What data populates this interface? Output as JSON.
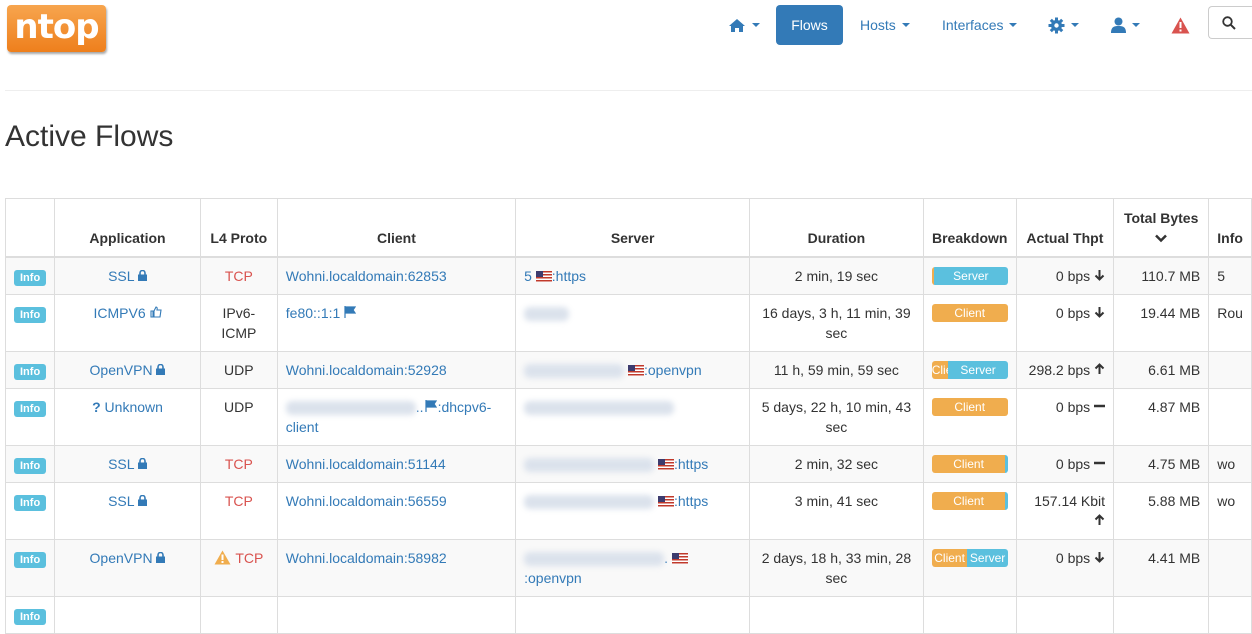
{
  "brand": {
    "logo_text": "ntop"
  },
  "nav": {
    "flows_label": "Flows",
    "hosts_label": "Hosts",
    "interfaces_label": "Interfaces"
  },
  "page_title": "Active Flows",
  "table": {
    "headers": {
      "info": "",
      "application": "Application",
      "l4proto": "L4 Proto",
      "client": "Client",
      "server": "Server",
      "duration": "Duration",
      "breakdown": "Breakdown",
      "thpt": "Actual Thpt",
      "bytes": "Total Bytes",
      "info_col": "Info"
    },
    "info_button": "Info",
    "rows": [
      {
        "app": "SSL",
        "app_icon": "lock-icon",
        "proto": "TCP",
        "client": "Wohni.localdomain:62853",
        "server_prefix": "5",
        "server_port": ":https",
        "duration": "2 min, 19 sec",
        "client_label": "",
        "server_label": "Server",
        "client_pct": 3,
        "thpt": "0 bps",
        "trend": "down",
        "bytes": "110.7 MB",
        "info": "5"
      },
      {
        "app": "ICMPV6",
        "app_icon": "thumbs-up-icon",
        "proto": "IPv6-ICMP",
        "client": "fe80::1:1",
        "server_prefix": "",
        "server_port": "",
        "duration": "16 days, 3 h, 11 min, 39 sec",
        "client_label": "Client",
        "server_label": "",
        "client_pct": 100,
        "thpt": "0 bps",
        "trend": "down",
        "bytes": "19.44 MB",
        "info": "Rou"
      },
      {
        "app": "OpenVPN",
        "app_icon": "lock-icon",
        "proto": "UDP",
        "client": "Wohni.localdomain:52928",
        "server_prefix": "",
        "server_port": ":openvpn",
        "duration": "11 h, 59 min, 59 sec",
        "client_label": "Clie",
        "server_label": "Server",
        "client_pct": 22,
        "thpt": "298.2 bps",
        "trend": "up",
        "bytes": "6.61 MB",
        "info": ""
      },
      {
        "app": "Unknown",
        "app_icon": "question-icon",
        "proto": "UDP",
        "client": "..",
        "client_port": ":dhcpv6-client",
        "server_prefix": "",
        "server_port": "",
        "duration": "5 days, 22 h, 10 min, 43 sec",
        "client_label": "Client",
        "server_label": "",
        "client_pct": 100,
        "thpt": "0 bps",
        "trend": "flat",
        "bytes": "4.87 MB",
        "info": ""
      },
      {
        "app": "SSL",
        "app_icon": "lock-icon",
        "proto": "TCP",
        "client": "Wohni.localdomain:51144",
        "server_prefix": "",
        "server_port": ":https",
        "duration": "2 min, 32 sec",
        "client_label": "Client",
        "server_label": "",
        "client_pct": 97,
        "thpt": "0 bps",
        "trend": "flat",
        "bytes": "4.75 MB",
        "info": "wo"
      },
      {
        "app": "SSL",
        "app_icon": "lock-icon",
        "proto": "TCP",
        "client": "Wohni.localdomain:56559",
        "server_prefix": "",
        "server_port": ":https",
        "duration": "3 min, 41 sec",
        "client_label": "Client",
        "server_label": "",
        "client_pct": 97,
        "thpt": "157.14 Kbit",
        "trend": "up",
        "bytes": "5.88 MB",
        "info": "wo"
      },
      {
        "app": "OpenVPN",
        "app_icon": "lock-icon",
        "proto": "TCP",
        "client": "Wohni.localdomain:58982",
        "server_prefix": ".",
        "server_port": ":openvpn",
        "duration": "2 days, 18 h, 33 min, 28 sec",
        "client_label": "Client",
        "server_label": "Server",
        "client_pct": 47,
        "thpt": "0 bps",
        "trend": "down",
        "bytes": "4.41 MB",
        "info": ""
      }
    ]
  }
}
